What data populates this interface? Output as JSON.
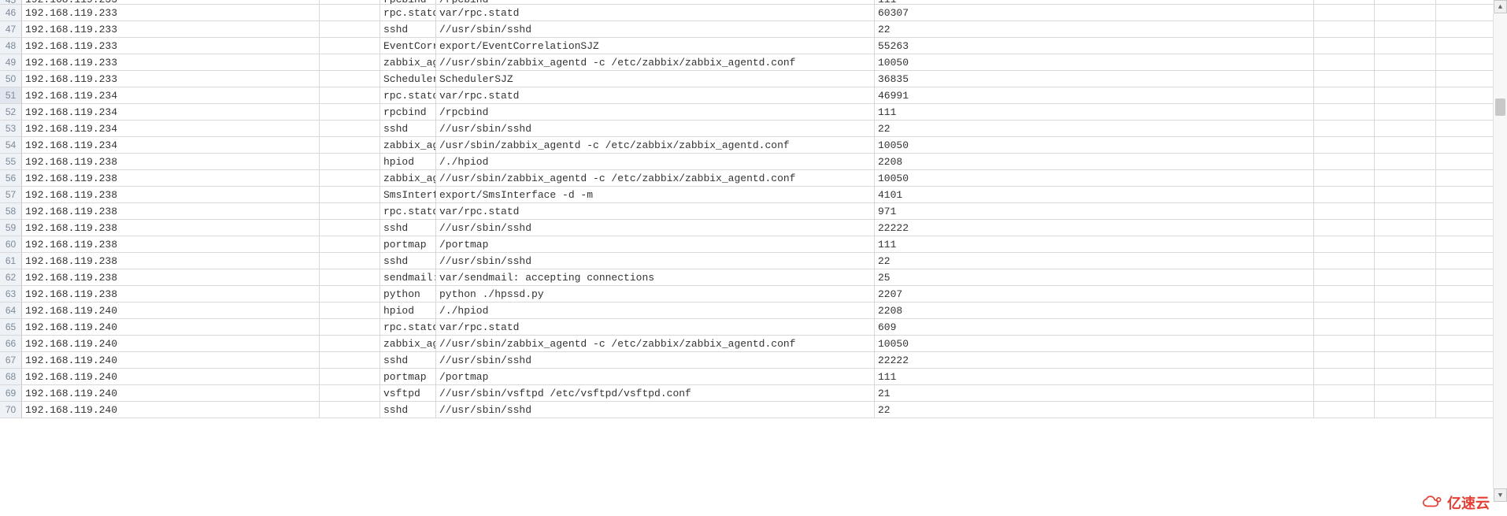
{
  "partial_top_row": {
    "num": "45",
    "ip": "192.168.119.233",
    "proc": "rpcbind",
    "path": "/rpcbind",
    "port": "111"
  },
  "rows": [
    {
      "num": "46",
      "ip": "192.168.119.233",
      "proc": "rpc.statd",
      "path": "var/rpc.statd",
      "port": "60307"
    },
    {
      "num": "47",
      "ip": "192.168.119.233",
      "proc": "sshd",
      "path": "//usr/sbin/sshd",
      "port": "22"
    },
    {
      "num": "48",
      "ip": "192.168.119.233",
      "proc": "EventCorrelat",
      "path": "export/EventCorrelationSJZ",
      "port": "55263"
    },
    {
      "num": "49",
      "ip": "192.168.119.233",
      "proc": "zabbix_agentd",
      "path": "//usr/sbin/zabbix_agentd -c /etc/zabbix/zabbix_agentd.conf",
      "port": "10050"
    },
    {
      "num": "50",
      "ip": "192.168.119.233",
      "proc": "SchedulerSJZ",
      "path": "SchedulerSJZ",
      "port": "36835"
    },
    {
      "num": "51",
      "ip": "192.168.119.234",
      "proc": "rpc.statd",
      "path": "var/rpc.statd",
      "port": "46991"
    },
    {
      "num": "52",
      "ip": "192.168.119.234",
      "proc": "rpcbind",
      "path": "/rpcbind",
      "port": "111"
    },
    {
      "num": "53",
      "ip": "192.168.119.234",
      "proc": "sshd",
      "path": "//usr/sbin/sshd",
      "port": "22"
    },
    {
      "num": "54",
      "ip": "192.168.119.234",
      "proc": "zabbix_agentd",
      "path": "/usr/sbin/zabbix_agentd -c /etc/zabbix/zabbix_agentd.conf",
      "port": "10050"
    },
    {
      "num": "55",
      "ip": "192.168.119.238",
      "proc": "hpiod",
      "path": "/./hpiod",
      "port": "2208"
    },
    {
      "num": "56",
      "ip": "192.168.119.238",
      "proc": "zabbix_agentd",
      "path": "//usr/sbin/zabbix_agentd -c /etc/zabbix/zabbix_agentd.conf",
      "port": "10050"
    },
    {
      "num": "57",
      "ip": "192.168.119.238",
      "proc": "SmsInterface",
      "path": "export/SmsInterface -d -m",
      "port": "4101"
    },
    {
      "num": "58",
      "ip": "192.168.119.238",
      "proc": "rpc.statd",
      "path": "var/rpc.statd",
      "port": "971"
    },
    {
      "num": "59",
      "ip": "192.168.119.238",
      "proc": "sshd",
      "path": "//usr/sbin/sshd",
      "port": "22222"
    },
    {
      "num": "60",
      "ip": "192.168.119.238",
      "proc": "portmap",
      "path": "/portmap",
      "port": "111"
    },
    {
      "num": "61",
      "ip": "192.168.119.238",
      "proc": "sshd",
      "path": "//usr/sbin/sshd",
      "port": "22"
    },
    {
      "num": "62",
      "ip": "192.168.119.238",
      "proc": "sendmail:",
      "path": "var/sendmail: accepting connections",
      "port": "25"
    },
    {
      "num": "63",
      "ip": "192.168.119.238",
      "proc": "python",
      "path": "python ./hpssd.py",
      "port": "2207"
    },
    {
      "num": "64",
      "ip": "192.168.119.240",
      "proc": "hpiod",
      "path": "/./hpiod",
      "port": "2208"
    },
    {
      "num": "65",
      "ip": "192.168.119.240",
      "proc": "rpc.statd",
      "path": "var/rpc.statd",
      "port": "609"
    },
    {
      "num": "66",
      "ip": "192.168.119.240",
      "proc": "zabbix_agentd",
      "path": "//usr/sbin/zabbix_agentd -c /etc/zabbix/zabbix_agentd.conf",
      "port": "10050"
    },
    {
      "num": "67",
      "ip": "192.168.119.240",
      "proc": "sshd",
      "path": "//usr/sbin/sshd",
      "port": "22222"
    },
    {
      "num": "68",
      "ip": "192.168.119.240",
      "proc": "portmap",
      "path": "/portmap",
      "port": "111"
    },
    {
      "num": "69",
      "ip": "192.168.119.240",
      "proc": "vsftpd",
      "path": "//usr/sbin/vsftpd /etc/vsftpd/vsftpd.conf",
      "port": "21"
    },
    {
      "num": "70",
      "ip": "192.168.119.240",
      "proc": "sshd",
      "path": "//usr/sbin/sshd",
      "port": "22"
    }
  ],
  "focused_row_num": "51",
  "logo_text": "亿速云"
}
